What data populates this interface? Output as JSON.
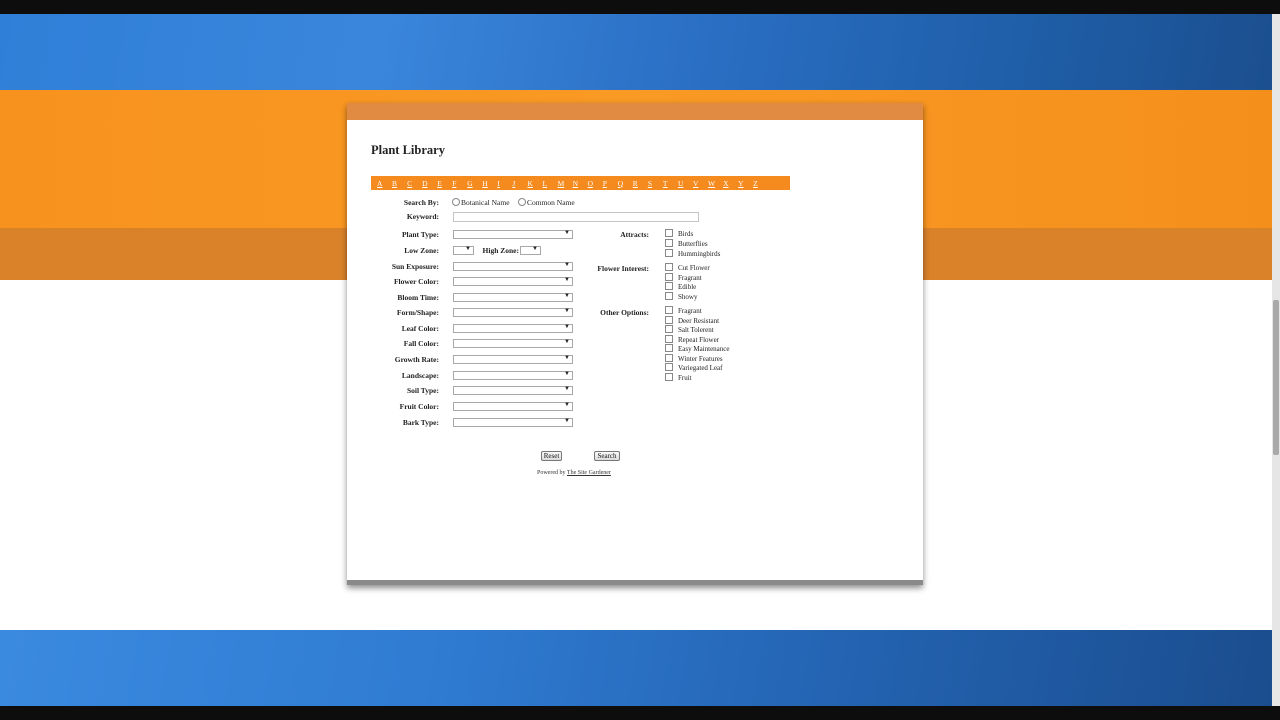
{
  "page": {
    "title": "Plant Library"
  },
  "alphabet": [
    "A",
    "B",
    "C",
    "D",
    "E",
    "F",
    "G",
    "H",
    "I",
    "J",
    "K",
    "L",
    "M",
    "N",
    "O",
    "P",
    "Q",
    "R",
    "S",
    "T",
    "U",
    "V",
    "W",
    "X",
    "Y",
    "Z"
  ],
  "search_by": {
    "label": "Search By:",
    "options": [
      "Botanical Name",
      "Common Name"
    ]
  },
  "keyword": {
    "label": "Keyword:",
    "value": ""
  },
  "fields": {
    "plant_type": "Plant Type:",
    "low_zone": "Low Zone:",
    "high_zone": "High Zone:",
    "sun_exposure": "Sun Exposure:",
    "flower_color": "Flower Color:",
    "bloom_time": "Bloom Time:",
    "form_shape": "Form/Shape:",
    "leaf_color": "Leaf Color:",
    "fall_color": "Fall Color:",
    "growth_rate": "Growth Rate:",
    "landscape": "Landscape:",
    "soil_type": "Soil Type:",
    "fruit_color": "Fruit Color:",
    "bark_type": "Bark Type:"
  },
  "attracts": {
    "label": "Attracts:",
    "options": [
      "Birds",
      "Butterflies",
      "Hummingbirds"
    ]
  },
  "flower_interest": {
    "label": "Flower Interest:",
    "options": [
      "Cut Flower",
      "Fragrant",
      "Edible",
      "Showy"
    ]
  },
  "other_options": {
    "label": "Other Options:",
    "options": [
      "Fragrant",
      "Deer Resistant",
      "Salt Tolerent",
      "Repeat Flower",
      "Easy Maintenance",
      "Winter Features",
      "Variegated Leaf",
      "Fruit"
    ]
  },
  "buttons": {
    "reset": "Reset",
    "search": "Search"
  },
  "footer": {
    "powered_by": "Powered by",
    "link_text": "The Site Gardener"
  },
  "colors": {
    "accent_orange": "#f58a1f",
    "blue": "#2f7fd8"
  }
}
